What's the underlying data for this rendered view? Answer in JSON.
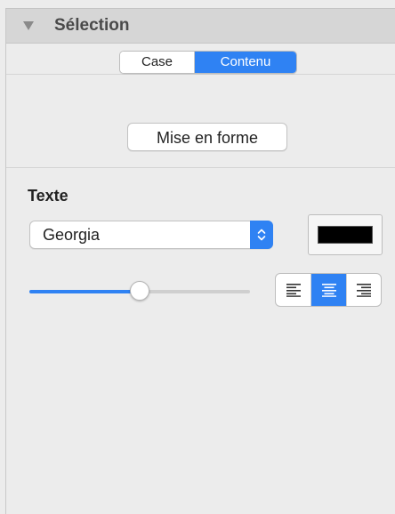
{
  "header": {
    "title": "Sélection",
    "disclosure_icon": "disclosure-triangle-down"
  },
  "tabs": [
    {
      "label": "Case",
      "selected": false
    },
    {
      "label": "Contenu",
      "selected": true
    }
  ],
  "format_button": {
    "label": "Mise en forme"
  },
  "text_section": {
    "label": "Texte",
    "font": {
      "value": "Georgia",
      "arrow_icon": "updown-chevron"
    },
    "color": {
      "value": "#000000"
    },
    "size_slider": {
      "value": 0.5
    },
    "alignment": {
      "options": [
        "left",
        "center",
        "right"
      ],
      "selected": "center"
    }
  },
  "colors": {
    "accent": "#2f82f3",
    "panel_bg": "#ececec",
    "header_bg": "#d6d6d6"
  }
}
